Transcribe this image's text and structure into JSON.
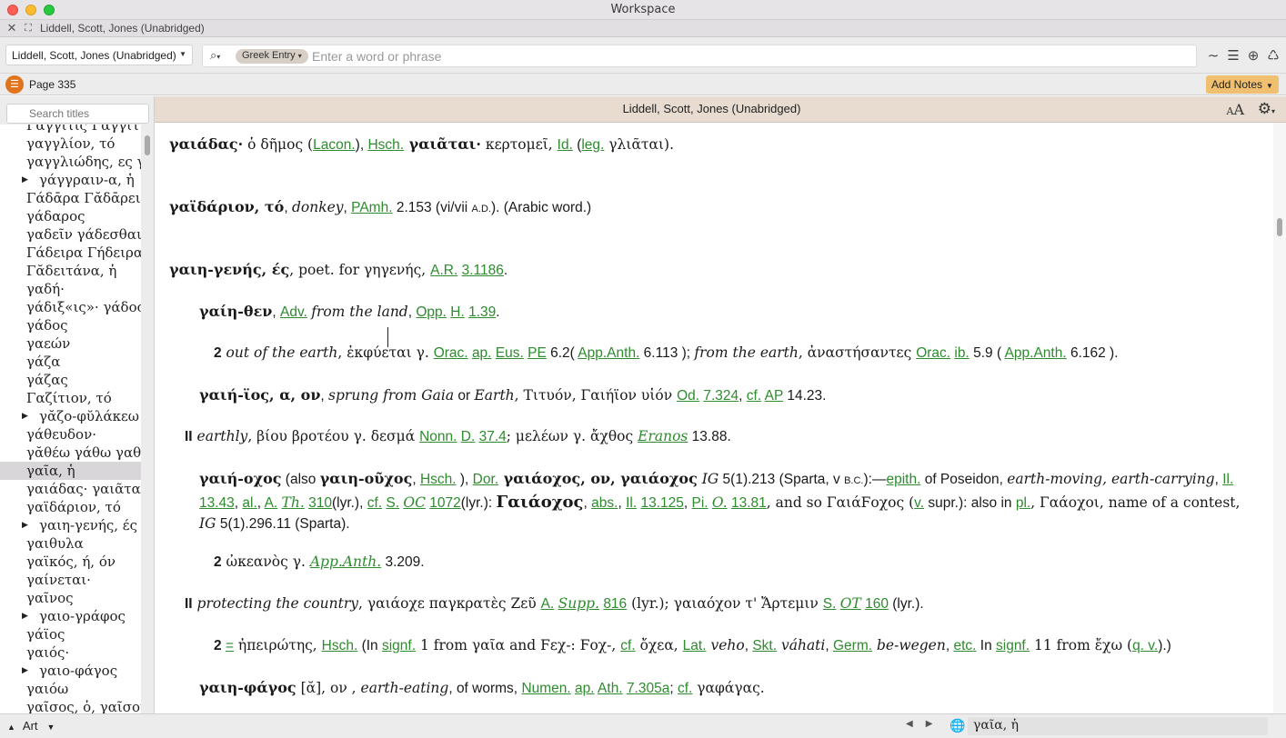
{
  "window": {
    "title": "Workspace"
  },
  "tab": {
    "close": "✕",
    "expand": "⛶",
    "label": "Liddell, Scott, Jones (Unabridged)"
  },
  "toolbar": {
    "resource": "Liddell, Scott, Jones (Unabridged)",
    "search_type": "Greek Entry",
    "search_placeholder": "Enter a word or phrase",
    "icons": [
      "waveform-icon",
      "outline-icon",
      "add-circle-icon",
      "recycle-icon"
    ]
  },
  "pagebar": {
    "page": "Page 335",
    "add_notes": "Add Notes"
  },
  "sidebar": {
    "search_placeholder": "Search titles",
    "items": [
      {
        "label": "Γαγγίτις Γαγγίτι",
        "tri": false
      },
      {
        "label": "γαγγλίον, τό",
        "tri": false
      },
      {
        "label": "γαγγλιώδης, ες γ",
        "tri": false
      },
      {
        "label": "γάγγραιν-α, ἡ",
        "tri": true
      },
      {
        "label": "Γάδᾱρα Γᾰδᾱρει",
        "tri": false
      },
      {
        "label": "γάδαρος",
        "tri": false
      },
      {
        "label": "γαδεῖν γάδεσθαι",
        "tri": false
      },
      {
        "label": "Γάδειρα Γήδειρα",
        "tri": false
      },
      {
        "label": "Γᾰδειτάνα, ἡ",
        "tri": false
      },
      {
        "label": "γαδή·",
        "tri": false
      },
      {
        "label": "γάδιξ«ις»· γάδος·",
        "tri": false
      },
      {
        "label": "γάδος",
        "tri": false
      },
      {
        "label": "γαεών",
        "tri": false
      },
      {
        "label": "γάζα",
        "tri": false
      },
      {
        "label": "γάζας",
        "tri": false
      },
      {
        "label": "Γαζίτιον, τό",
        "tri": false
      },
      {
        "label": "γᾰζο-φῠλάκεω",
        "tri": true
      },
      {
        "label": "γάθευδον·",
        "tri": false
      },
      {
        "label": "γᾰθέω γάθω γαθ",
        "tri": false
      },
      {
        "label": "γαῖα, ἡ",
        "tri": false,
        "selected": true
      },
      {
        "label": "γαιάδας· γαιᾶτα",
        "tri": false
      },
      {
        "label": "γαϊδάριον, τό",
        "tri": false
      },
      {
        "label": "γαιη-γενής, ές",
        "tri": true
      },
      {
        "label": "γαιθυλα",
        "tri": false
      },
      {
        "label": "γαϊκός, ή, όν",
        "tri": false
      },
      {
        "label": "γαίνεται·",
        "tri": false
      },
      {
        "label": "γαῖνος",
        "tri": false
      },
      {
        "label": "γαιο-γράφος",
        "tri": true
      },
      {
        "label": "γάϊος",
        "tri": false
      },
      {
        "label": "γαιός·",
        "tri": false
      },
      {
        "label": "γαιο-φάγος",
        "tri": true
      },
      {
        "label": "γαιόω",
        "tri": false
      },
      {
        "label": "γαῖσος, ὁ, γαῖσον",
        "tri": false
      }
    ],
    "bottom_label": "Art"
  },
  "content": {
    "title": "Liddell, Scott, Jones (Unabridged)",
    "entries": {
      "e1": {
        "hw": "γαιάδας·",
        "t1": " ὁ δῆμος (",
        "l1": "Lacon.",
        "t2": "), ",
        "l2": "Hsch.",
        "hw2": " γαιᾶται·",
        "t3": " κερτομεῖ, ",
        "l3": "Id.",
        "t4": " (",
        "l4": "leg.",
        "t5": " γλιᾶται)."
      },
      "e2": {
        "hw": "γαϊδάριον, τό",
        "t1": ", ",
        "i1": "donkey",
        "t2": ", ",
        "l1": "PAmh.",
        "t3": " 2.153 (vi/vii ",
        "sc": "A.D.",
        "t4": "). (Arabic word.)"
      },
      "e3": {
        "hw": "γαιη-γενής, ές",
        "t1": ", poet. for γηγενής, ",
        "l1": "A.R.",
        "t2": " ",
        "l2": "3.1186",
        "t3": "."
      },
      "e4": {
        "hw": "γαίη-θεν",
        "t1": ", ",
        "l1": "Adv.",
        "t2": " ",
        "i1": "from the land",
        "t3": ", ",
        "l2": "Opp.",
        "t4": " ",
        "l3": "H.",
        "t5": " ",
        "l4": "1.39",
        "t6": "."
      },
      "e5": {
        "num": "2",
        "i1": " out of the earth",
        "t1": ", ἐκφύεται γ. ",
        "l1": "Orac.",
        "t2": " ",
        "l2": "ap.",
        "t3": " ",
        "l3": "Eus.",
        "t4": " ",
        "l4": "PE",
        "t5": " 6.2( ",
        "l5": "App.Anth.",
        "t6": " 6.113 ); ",
        "i2": "from the earth",
        "t7": ", ἀναστήσαντες ",
        "l6": "Orac.",
        "t8": " ",
        "l7": "ib.",
        "t9": " 5.9 ( ",
        "l8": "App.Anth.",
        "t10": " 6.162 )."
      },
      "e6": {
        "hw": "γαιή-ϊος, α, ον",
        "t1": ", ",
        "i1": "sprung from Gaia",
        "t2": " or ",
        "i2": "Earth",
        "t3": ", Τιτυόν, Γαιήϊον υἱόν ",
        "l1": "Od.",
        "t4": " ",
        "l2": "7.324",
        "t5": ", ",
        "l3": "cf.",
        "t6": " ",
        "l4": "AP",
        "t7": " 14.23."
      },
      "e7": {
        "num": "II",
        "i1": " earthly",
        "t1": ", βίου βροτέου γ. δεσμά ",
        "l1": "Nonn.",
        "t2": " ",
        "l2": "D.",
        "t3": " ",
        "l3": "37.4",
        "t4": "; μελέων γ. ἄχθος ",
        "l4": "Eranos",
        "t5": " 13.88."
      },
      "e8": {
        "hw": "γαιή-οχος",
        "t1": " (also ",
        "hw2": "γαιη-οῦχος",
        "t2": ", ",
        "l1": "Hsch.",
        "t3": " ), ",
        "l2": "Dor.",
        "hw3": " γαιάοχος, ον, γαιάοχος",
        "i1": " IG",
        "t4": " 5(1).213 (Sparta, v ",
        "sc": "B.C.",
        "t5": "):—",
        "l3": "epith.",
        "t6": " of Poseidon, ",
        "i2": "earth-moving, earth-carrying",
        "t7": ", ",
        "l4": "Il.",
        "t8": " ",
        "l5": "13.43",
        "t9": ", ",
        "l6": "al.",
        "t10": ", ",
        "l7": "A.",
        "t11": " ",
        "l8": "Th.",
        "t12": " ",
        "l9": "310",
        "t13": "(lyr.), ",
        "l10": "cf.",
        "t14": " ",
        "l11": "S.",
        "t15": " ",
        "l12": "OC",
        "t16": " ",
        "l13": "1072",
        "t17": "(lyr.): ",
        "hw4": "Γαιάοχος",
        "t18": ", ",
        "l14": "abs.",
        "t19": ", ",
        "l15": "Il.",
        "t20": " ",
        "l16": "13.125",
        "t21": ", ",
        "l17": "Pi.",
        "t22": " ",
        "l18": "O.",
        "t23": " ",
        "l19": "13.81",
        "t24": ", and so ΓαιάϜοχος (",
        "l20": "v.",
        "t25": " supr.): also in ",
        "l21": "pl.",
        "t26": ", Γαάοχοι, name of a contest, ",
        "i3": "IG",
        "t27": " 5(1).296.11 (Sparta)."
      },
      "e9": {
        "num": "2",
        "t1": " ὠκεανὸς γ. ",
        "l1": "App.Anth.",
        "t2": " 3.209."
      },
      "e10": {
        "num": "II",
        "i1": " protecting the country",
        "t1": ", γαιάοχε παγκρατὲς Ζεῦ ",
        "l1": "A.",
        "t2": " ",
        "l2": "Supp.",
        "t3": " ",
        "l3": "816",
        "t4": " (lyr.); γαιαόχον τ' Ἄρτεμιν ",
        "l4": "S.",
        "t5": " ",
        "l5": "OT",
        "t6": " ",
        "l6": "160",
        "t7": " (lyr.)."
      },
      "e11": {
        "num": "2",
        "t0": " ",
        "l0": "=",
        "t1": " ἠπειρώτης, ",
        "l1": "Hsch.",
        "t2": " (In ",
        "l2": "signf.",
        "t3": " 1 from γαῖα and Ϝεχ-: Ϝοχ-, ",
        "l3": "cf.",
        "t4": " ὄχεα, ",
        "l4": "Lat.",
        "i1": " veho",
        "t5": ", ",
        "l5": "Skt.",
        "i2": " váhati",
        "t6": ", ",
        "l6": "Germ.",
        "i3": " be-wegen",
        "t7": ", ",
        "l7": "etc.",
        "t8": " In ",
        "l8": "signf.",
        "t9": " 11 from ἔχω (",
        "l9": "q. v.",
        "t10": ").)"
      },
      "e12": {
        "hw": "γαιη-φάγος",
        "t1": " [ᾰ], ον , ",
        "i1": "earth-eating",
        "t2": ", of worms, ",
        "l1": "Numen.",
        "t3": " ",
        "l2": "ap.",
        "t4": " ",
        "l3": "Ath.",
        "t5": " ",
        "l4": "7.305a",
        "t6": "; ",
        "l5": "cf.",
        "t7": " γαφάγας."
      }
    }
  },
  "status": {
    "field": "γαῖα, ἡ"
  },
  "colors": {
    "accent": "#e0731b",
    "link": "#2e8b2e",
    "header": "#e8dcd0",
    "notes": "#f0c070"
  }
}
